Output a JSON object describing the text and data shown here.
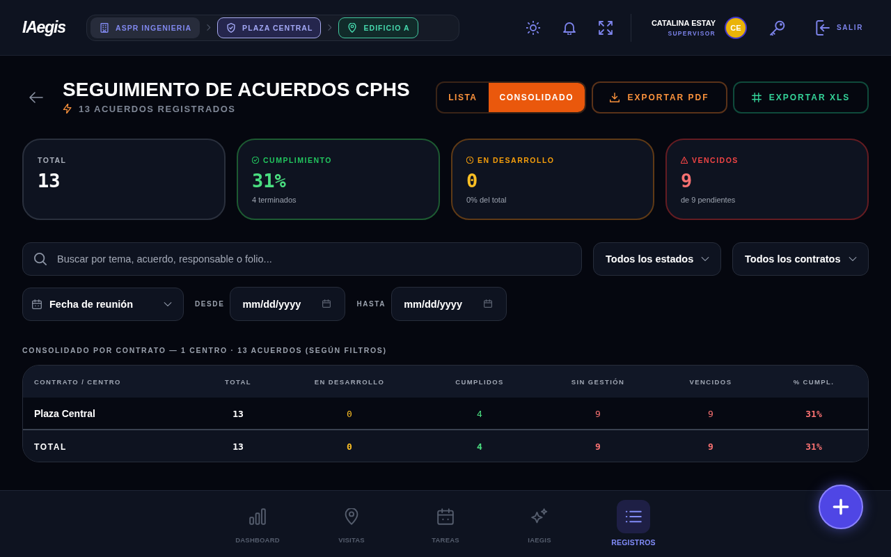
{
  "header": {
    "logo": "IAegis",
    "breadcrumb": [
      {
        "label": "ASPR INGENIERIA",
        "kind": "company"
      },
      {
        "label": "PLAZA CENTRAL",
        "kind": "site"
      },
      {
        "label": "EDIFICIO A",
        "kind": "building"
      }
    ],
    "user": {
      "name": "CATALINA ESTAY",
      "role": "SUPERVISOR",
      "initials": "CE"
    },
    "logout": "SALIR"
  },
  "page": {
    "title": "SEGUIMIENTO DE ACUERDOS CPHS",
    "subtitle": "13 ACUERDOS REGISTRADOS",
    "view_toggle": [
      {
        "label": "LISTA",
        "selected": false
      },
      {
        "label": "CONSOLIDADO",
        "selected": true
      }
    ],
    "actions": [
      {
        "label": "EXPORTAR PDF",
        "kind": "pdf"
      },
      {
        "label": "EXPORTAR XLS",
        "kind": "xls"
      }
    ]
  },
  "stats": [
    {
      "kind": "total",
      "label": "TOTAL",
      "value": "13"
    },
    {
      "kind": "done",
      "label": "CUMPLIMIENTO",
      "value": "31%",
      "note": "4 terminados"
    },
    {
      "kind": "progress",
      "label": "EN DESARROLLO",
      "value": "0",
      "note": "0% del total"
    },
    {
      "kind": "overdue",
      "label": "VENCIDOS",
      "value": "9",
      "note": "de 9 pendientes"
    }
  ],
  "filters": {
    "search": {
      "placeholder": "Buscar por tema, acuerdo, responsable o folio..."
    },
    "status": {
      "value": "Todos los estados"
    },
    "contract": {
      "value": "Todos los contratos"
    },
    "date_field": {
      "value": "Fecha de reunión"
    },
    "from": {
      "label": "DESDE",
      "placeholder": "mm/dd/yyyy"
    },
    "to": {
      "label": "HASTA",
      "placeholder": "mm/dd/yyyy"
    }
  },
  "table": {
    "title": "CONSOLIDADO POR CONTRATO — 1 CENTRO · 13 ACUERDOS (SEGÚN FILTROS)",
    "columns": [
      {
        "label": "CONTRATO / CENTRO",
        "kind": "name"
      },
      {
        "label": "TOTAL",
        "kind": "total"
      },
      {
        "label": "EN DESARROLLO",
        "kind": "progress"
      },
      {
        "label": "CUMPLIDOS",
        "kind": "done"
      },
      {
        "label": "SIN GESTIÓN",
        "kind": "unmanaged"
      },
      {
        "label": "VENCIDOS",
        "kind": "overdue"
      },
      {
        "label": "% CUMPL.",
        "kind": "rate"
      }
    ],
    "rows": [
      {
        "cells": [
          "Plaza Central",
          "13",
          "0",
          "4",
          "9",
          "9",
          "31%"
        ]
      }
    ],
    "total": {
      "cells": [
        "TOTAL",
        "13",
        "0",
        "4",
        "9",
        "9",
        "31%"
      ]
    }
  },
  "bottom_nav": [
    {
      "label": "DASHBOARD",
      "selected": false
    },
    {
      "label": "VISITAS",
      "selected": false
    },
    {
      "label": "TAREAS",
      "selected": false
    },
    {
      "label": "IAEGIS",
      "selected": false
    },
    {
      "label": "REGISTROS",
      "selected": true
    }
  ]
}
